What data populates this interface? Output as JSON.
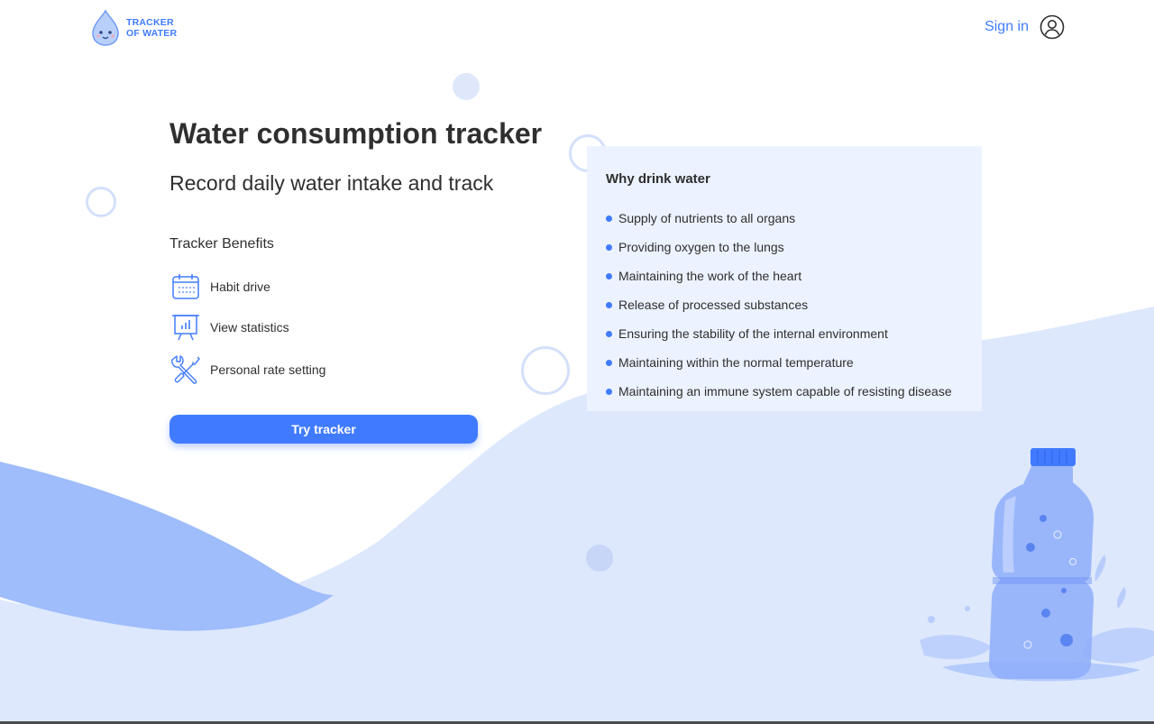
{
  "header": {
    "logo_line1": "TRACKER",
    "logo_line2": "OF WATER",
    "signin_label": "Sign in",
    "user_icon": "user-circle-icon"
  },
  "hero": {
    "title": "Water consumption tracker",
    "subtitle": "Record daily water intake and track",
    "benefits_title": "Tracker Benefits",
    "benefits": [
      {
        "label": "Habit drive",
        "icon": "calendar-icon"
      },
      {
        "label": "View statistics",
        "icon": "statistics-board-icon"
      },
      {
        "label": "Personal rate setting",
        "icon": "tools-icon"
      }
    ],
    "cta_label": "Try tracker"
  },
  "why": {
    "title": "Why drink water",
    "items": [
      "Supply of nutrients to all organs",
      "Providing oxygen to the lungs",
      "Maintaining the work of the heart",
      "Release of processed substances",
      "Ensuring the stability of the internal environment",
      "Maintaining within the normal temperature",
      "Maintaining an immune system capable of resisting disease"
    ]
  },
  "colors": {
    "accent": "#407bff",
    "text": "#2f2f2f",
    "panel_bg": "#ecf2ff",
    "wave_light": "#dce7fd",
    "wave_dark": "#9ebbff"
  }
}
